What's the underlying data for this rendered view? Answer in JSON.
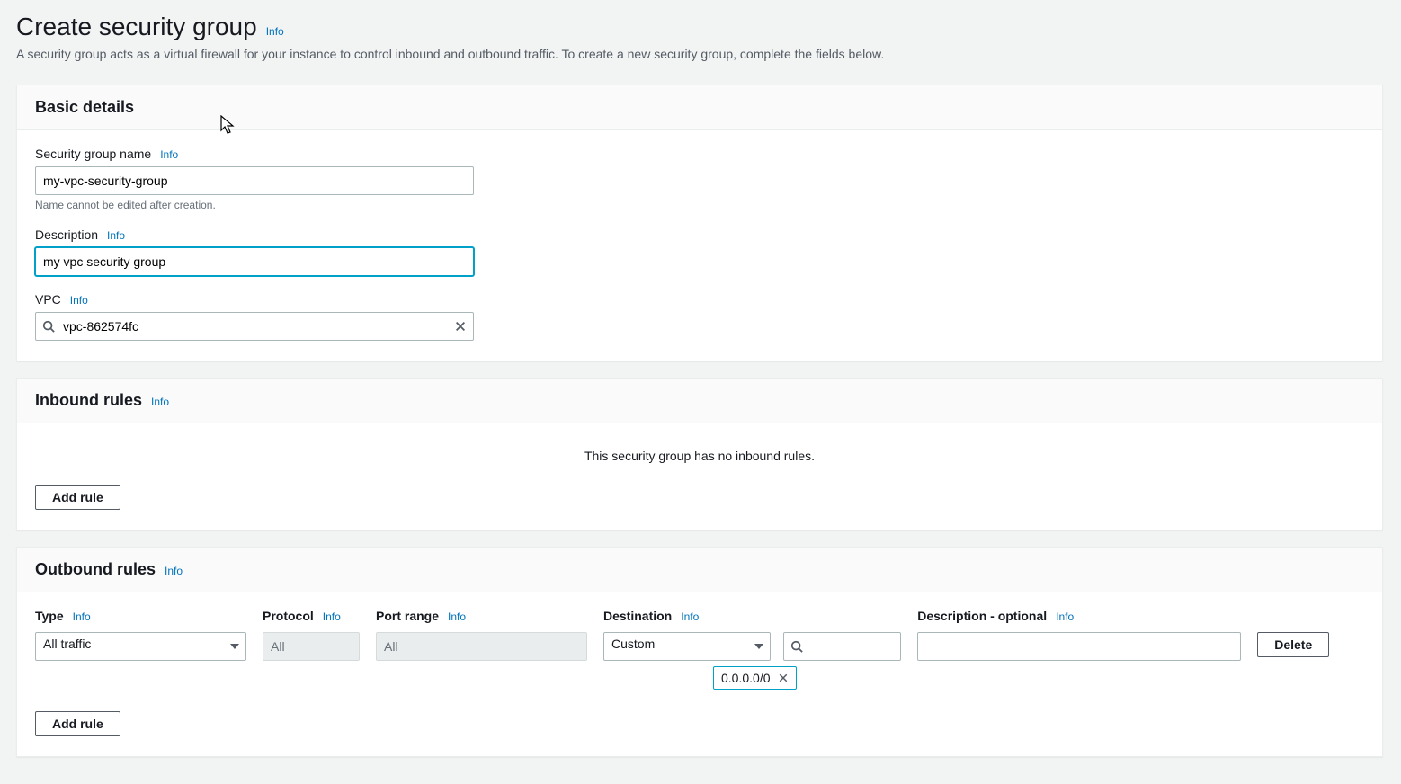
{
  "page": {
    "title": "Create security group",
    "info": "Info",
    "subtitle": "A security group acts as a virtual firewall for your instance to control inbound and outbound traffic. To create a new security group, complete the fields below."
  },
  "basic": {
    "header": "Basic details",
    "name_label": "Security group name",
    "name_value": "my-vpc-security-group",
    "name_hint": "Name cannot be edited after creation.",
    "desc_label": "Description",
    "desc_value": "my vpc security group",
    "vpc_label": "VPC",
    "vpc_value": "vpc-862574fc"
  },
  "inbound": {
    "header": "Inbound rules",
    "empty_msg": "This security group has no inbound rules.",
    "add_rule": "Add rule"
  },
  "outbound": {
    "header": "Outbound rules",
    "add_rule": "Add rule",
    "cols": {
      "type": "Type",
      "protocol": "Protocol",
      "port": "Port range",
      "dest": "Destination",
      "desc": "Description - optional"
    },
    "row": {
      "type": "All traffic",
      "protocol": "All",
      "port": "All",
      "dest_mode": "Custom",
      "dest_token": "0.0.0.0/0",
      "delete": "Delete"
    }
  },
  "common": {
    "info": "Info"
  }
}
